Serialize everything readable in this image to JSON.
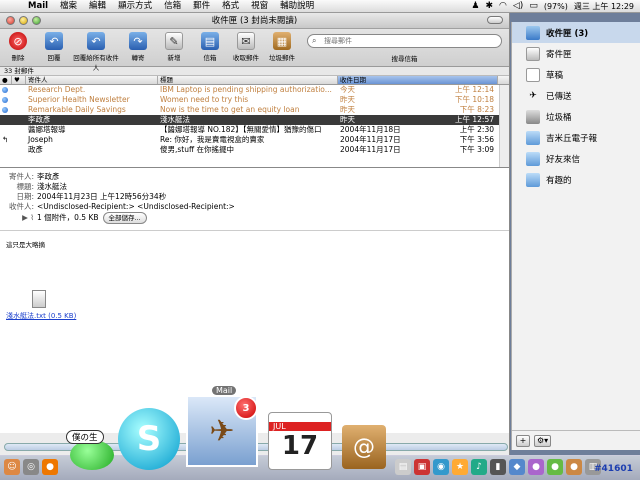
{
  "menubar": {
    "app": "Mail",
    "items": [
      "檔案",
      "編輯",
      "顯示方式",
      "信箱",
      "郵件",
      "格式",
      "視窗",
      "輔助說明"
    ],
    "battery": "(97%)",
    "clock": "週三 上午 12:29"
  },
  "window": {
    "title": "收件匣 (3 封尚未閱讀)"
  },
  "toolbar": {
    "buttons": [
      {
        "label": "刪除"
      },
      {
        "label": "回覆"
      },
      {
        "label": "回覆給所有收件人"
      },
      {
        "label": "轉寄"
      },
      {
        "label": "新增"
      },
      {
        "label": "信箱"
      },
      {
        "label": "收取郵件"
      },
      {
        "label": "垃圾郵件"
      }
    ],
    "search_placeholder": "搜尋郵件",
    "search_label": "搜尋信箱"
  },
  "list": {
    "count": "33 封郵件",
    "columns": {
      "from": "寄件人",
      "subject": "標題",
      "date": "收件日期"
    },
    "rows": [
      {
        "from": "Research Dept.",
        "subject": "IBM Laptop is pending shipping authorizatio...",
        "date": "今天",
        "time": "上午 12:14"
      },
      {
        "from": "Superior Health Newsletter",
        "subject": "Women need to try this",
        "date": "昨天",
        "time": "下午 10:18"
      },
      {
        "from": "Remarkable Daily Savings",
        "subject": "Now is the time to get an equity loan",
        "date": "昨天",
        "time": "下午 8:23"
      },
      {
        "from": "李政彥",
        "subject": "淺水艇法",
        "date": "昨天",
        "time": "上午 12:57"
      },
      {
        "from": "醬娜塔報導",
        "subject": "【醬娜塔報導 NO.182】【無關愛情】猶豫的傷口",
        "date": "2004年11月18日",
        "time": "上午 2:30"
      },
      {
        "from": "Joseph",
        "subject": "Re: 你好，我是賣電視盒的賣家",
        "date": "2004年11月17日",
        "time": "下午 3:56"
      },
      {
        "from": "政彥",
        "subject": "傻男,stuff 在你搖擺中",
        "date": "2004年11月17日",
        "time": "下午 3:09"
      }
    ]
  },
  "preview": {
    "from_label": "寄件人:",
    "from": "李政彥",
    "subject_label": "標題:",
    "subject": "淺水艇法",
    "date_label": "日期:",
    "date": "2004年11月23日 上午12時56分34秒",
    "to_label": "收件人:",
    "to": "<Undisclosed-Recipient:> <Undisclosed-Recipient:>",
    "attach": "1 個附件，0.5 KB",
    "save_all": "全部儲存...",
    "body": "這只是大略摘",
    "file": "淺水艇法.txt (0.5 KB)"
  },
  "drawer": {
    "mailboxes": [
      {
        "label": "收件匣 (3)"
      },
      {
        "label": "寄件匣"
      },
      {
        "label": "草稿"
      },
      {
        "label": "已傳送"
      },
      {
        "label": "垃圾桶"
      },
      {
        "label": "吉米丘電子報"
      },
      {
        "label": "好友來信"
      },
      {
        "label": "有趣的"
      }
    ]
  },
  "dock": {
    "bubble": "僕の生",
    "mail_label": "Mail",
    "mail_badge": "3",
    "ical_month": "JUL",
    "ical_day": "17",
    "watermark": "#41601"
  }
}
